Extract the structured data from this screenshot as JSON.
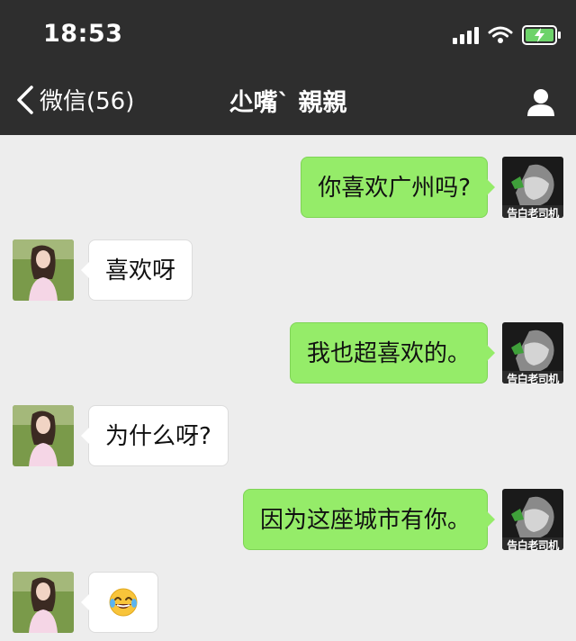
{
  "status_bar": {
    "time": "18:53"
  },
  "nav": {
    "back_label": "微信(56)",
    "title": "尐嘴ˋ  親親"
  },
  "messages": [
    {
      "side": "right",
      "text": "你喜欢广州吗?"
    },
    {
      "side": "left",
      "text": "喜欢呀"
    },
    {
      "side": "right",
      "text": "我也超喜欢的。"
    },
    {
      "side": "left",
      "text": "为什么呀?"
    },
    {
      "side": "right",
      "text": "因为这座城市有你。"
    },
    {
      "side": "left",
      "text": "😂"
    }
  ],
  "avatars": {
    "me_caption": "告白老司机"
  },
  "colors": {
    "topbar": "#2e2e2e",
    "chat_bg": "#ededed",
    "sent_bubble": "#95ec69",
    "received_bubble": "#ffffff",
    "battery": "#6dd36a"
  }
}
